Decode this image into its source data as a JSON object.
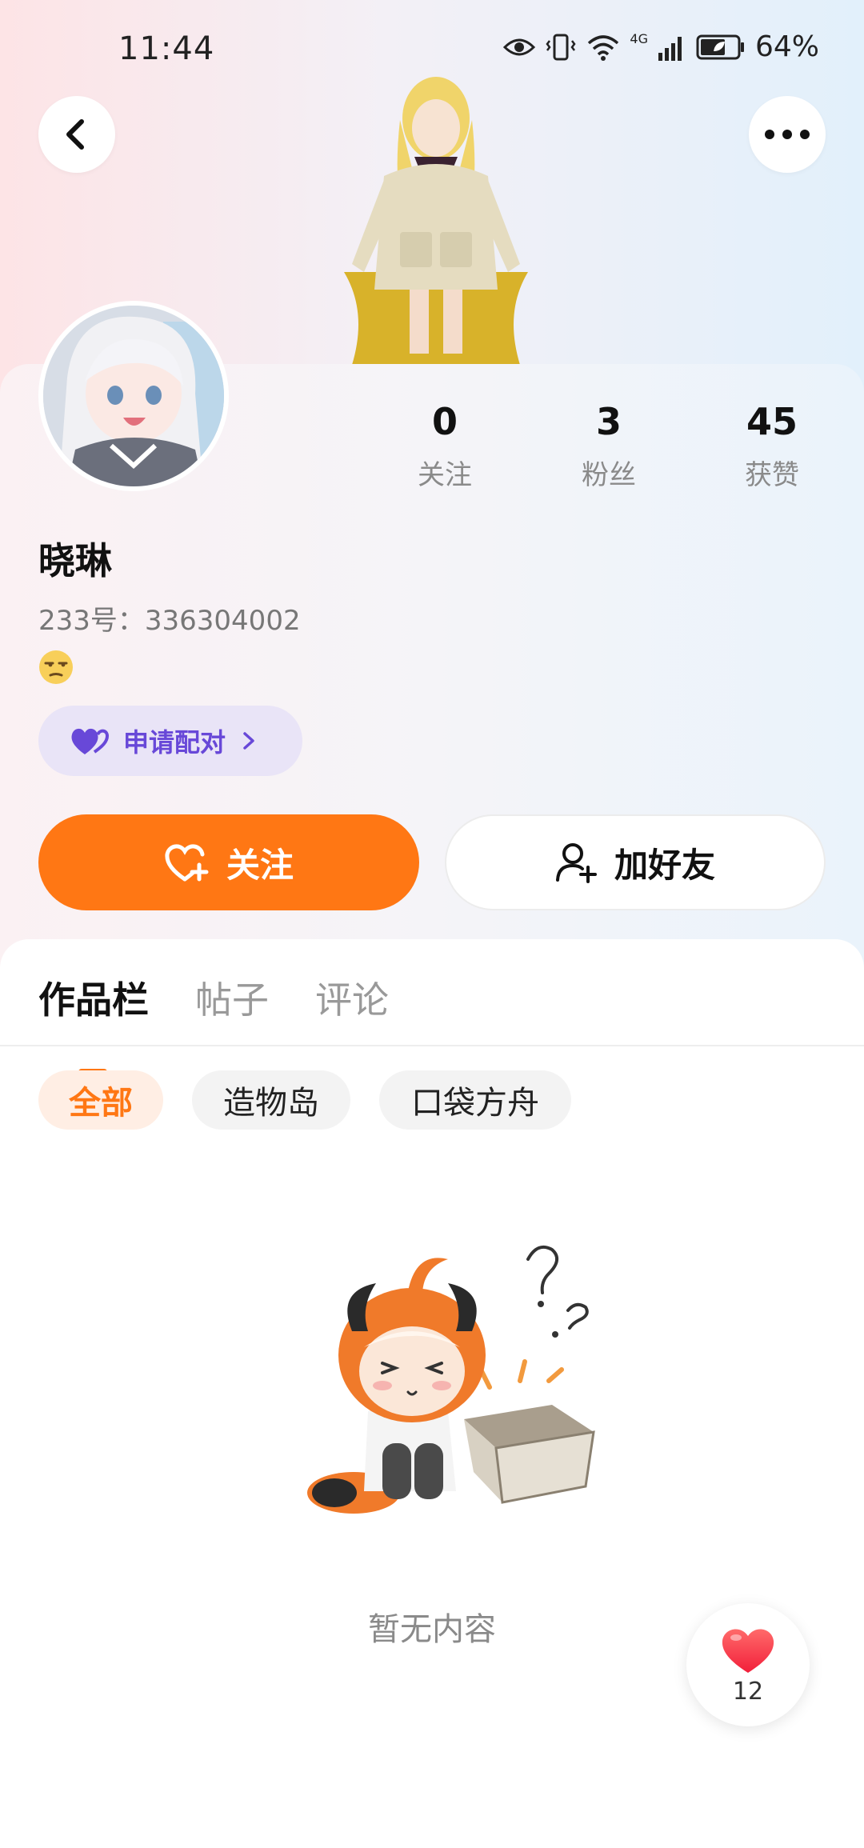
{
  "status_bar": {
    "time": "11:44",
    "network": "4G",
    "battery": "64%"
  },
  "header": {
    "back_icon": "chevron-left-icon",
    "more_icon": "more-dots-icon"
  },
  "profile": {
    "name": "晓琳",
    "uid": "233号：336304002",
    "stats": [
      {
        "value": "0",
        "label": "关注"
      },
      {
        "value": "3",
        "label": "粉丝"
      },
      {
        "value": "45",
        "label": "获赞"
      }
    ],
    "pair_button": "申请配对",
    "follow_button": "关注",
    "add_friend_button": "加好友"
  },
  "tabs": [
    {
      "label": "作品栏",
      "active": true
    },
    {
      "label": "帖子",
      "active": false
    },
    {
      "label": "评论",
      "active": false
    }
  ],
  "filters": [
    {
      "label": "全部",
      "active": true
    },
    {
      "label": "造物岛",
      "active": false
    },
    {
      "label": "口袋方舟",
      "active": false
    }
  ],
  "empty_state": {
    "text": "暂无内容"
  },
  "like_fab": {
    "count": "12"
  },
  "colors": {
    "accent": "#ff7714",
    "pair_purple": "#6848d8",
    "heart_red": "#ff3b4a"
  }
}
